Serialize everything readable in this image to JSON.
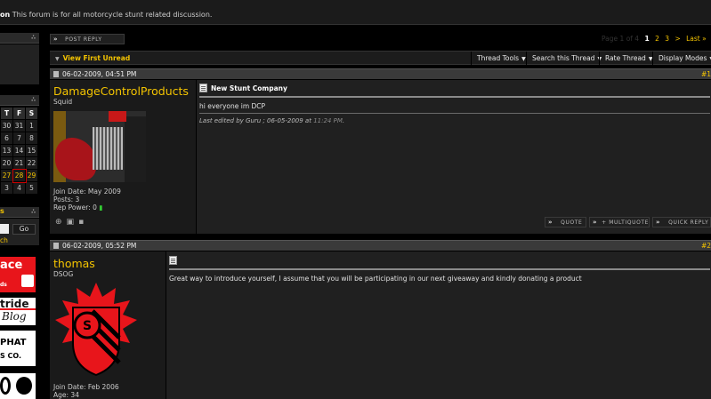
{
  "forum": {
    "description_prefix": "on",
    "description": "This forum is for all motorcycle stunt related discussion."
  },
  "sidebar": {
    "calendar": {
      "headers": [
        "T",
        "F",
        "S"
      ],
      "rows": [
        [
          "30",
          "31",
          "1"
        ],
        [
          "6",
          "7",
          "8"
        ],
        [
          "13",
          "14",
          "15"
        ],
        [
          "20",
          "21",
          "22"
        ],
        [
          "27",
          "28",
          "29"
        ],
        [
          "3",
          "4",
          "5"
        ]
      ]
    },
    "section_partial": "s",
    "go_label": "Go",
    "search_partial": "ch",
    "ads": [
      {
        "line1": "ace",
        "line2": "ds"
      },
      {
        "line1": "tride",
        "line2": "Blog"
      },
      {
        "line1": "PHAT",
        "line2": "S CO."
      }
    ]
  },
  "toolbar": {
    "post_reply": "POST REPLY",
    "view_first_unread": "View First Unread",
    "tools": [
      "Thread Tools",
      "Search this Thread",
      "Rate Thread",
      "Display Modes"
    ]
  },
  "pagination": {
    "label": "Page 1 of 4",
    "pages": [
      "1",
      "2",
      "3"
    ],
    "next": ">",
    "last": "Last »"
  },
  "posts": [
    {
      "date": "06-02-2009, 04:51 PM",
      "number": "#1",
      "username": "DamageControlProducts",
      "user_title": "Squid",
      "join_date": "Join Date: May 2009",
      "posts": "Posts: 3",
      "rep": "Rep Power: 0",
      "title": "New Stunt Company",
      "body": "hi everyone im DCP",
      "edited_prefix": "Last edited by Guru ; 06-05-2009 at",
      "edited_time": "11:24 PM",
      "edited_suffix": ".",
      "buttons": [
        "QUOTE",
        "+ MULTIQUOTE",
        "QUICK REPLY"
      ]
    },
    {
      "date": "06-02-2009, 05:52 PM",
      "number": "#2",
      "username": "thomas",
      "user_title": "DSOG",
      "join_date": "Join Date: Feb 2006",
      "age": "Age: 34",
      "body": "Great way to introduce yourself, I assume that you will be participating in our next giveaway and kindly donating a product"
    }
  ],
  "colors": {
    "accent": "#f4c400",
    "logo_red": "#e8151b"
  }
}
